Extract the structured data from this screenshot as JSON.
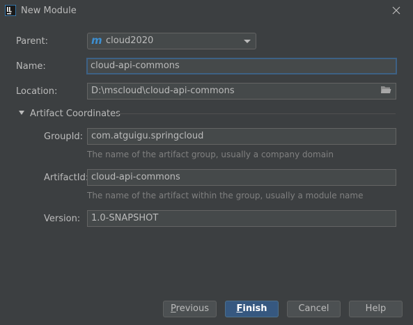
{
  "window": {
    "title": "New Module",
    "icon": "intellij-icon"
  },
  "form": {
    "parent_label": "Parent:",
    "parent_value": "cloud2020",
    "parent_icon_letter": "m",
    "name_label": "Name:",
    "name_value": "cloud-api-commons",
    "location_label": "Location:",
    "location_value": "D:\\mscloud\\cloud-api-commons"
  },
  "artifact": {
    "section_title": "Artifact Coordinates",
    "groupid_label": "GroupId:",
    "groupid_value": "com.atguigu.springcloud",
    "groupid_hint": "The name of the artifact group, usually a company domain",
    "artifactid_label": "ArtifactId:",
    "artifactid_value": "cloud-api-commons",
    "artifactid_hint": "The name of the artifact within the group, usually a module name",
    "version_label": "Version:",
    "version_value": "1.0-SNAPSHOT"
  },
  "buttons": {
    "previous": {
      "mnemonic": "P",
      "rest": "revious"
    },
    "finish": {
      "mnemonic": "F",
      "rest": "inish"
    },
    "cancel": "Cancel",
    "help": "Help"
  },
  "colors": {
    "background": "#3c3f41",
    "field": "#45494a",
    "focus_border": "#3d6185",
    "default_button": "#365880",
    "maven_blue": "#3d8fd1"
  }
}
